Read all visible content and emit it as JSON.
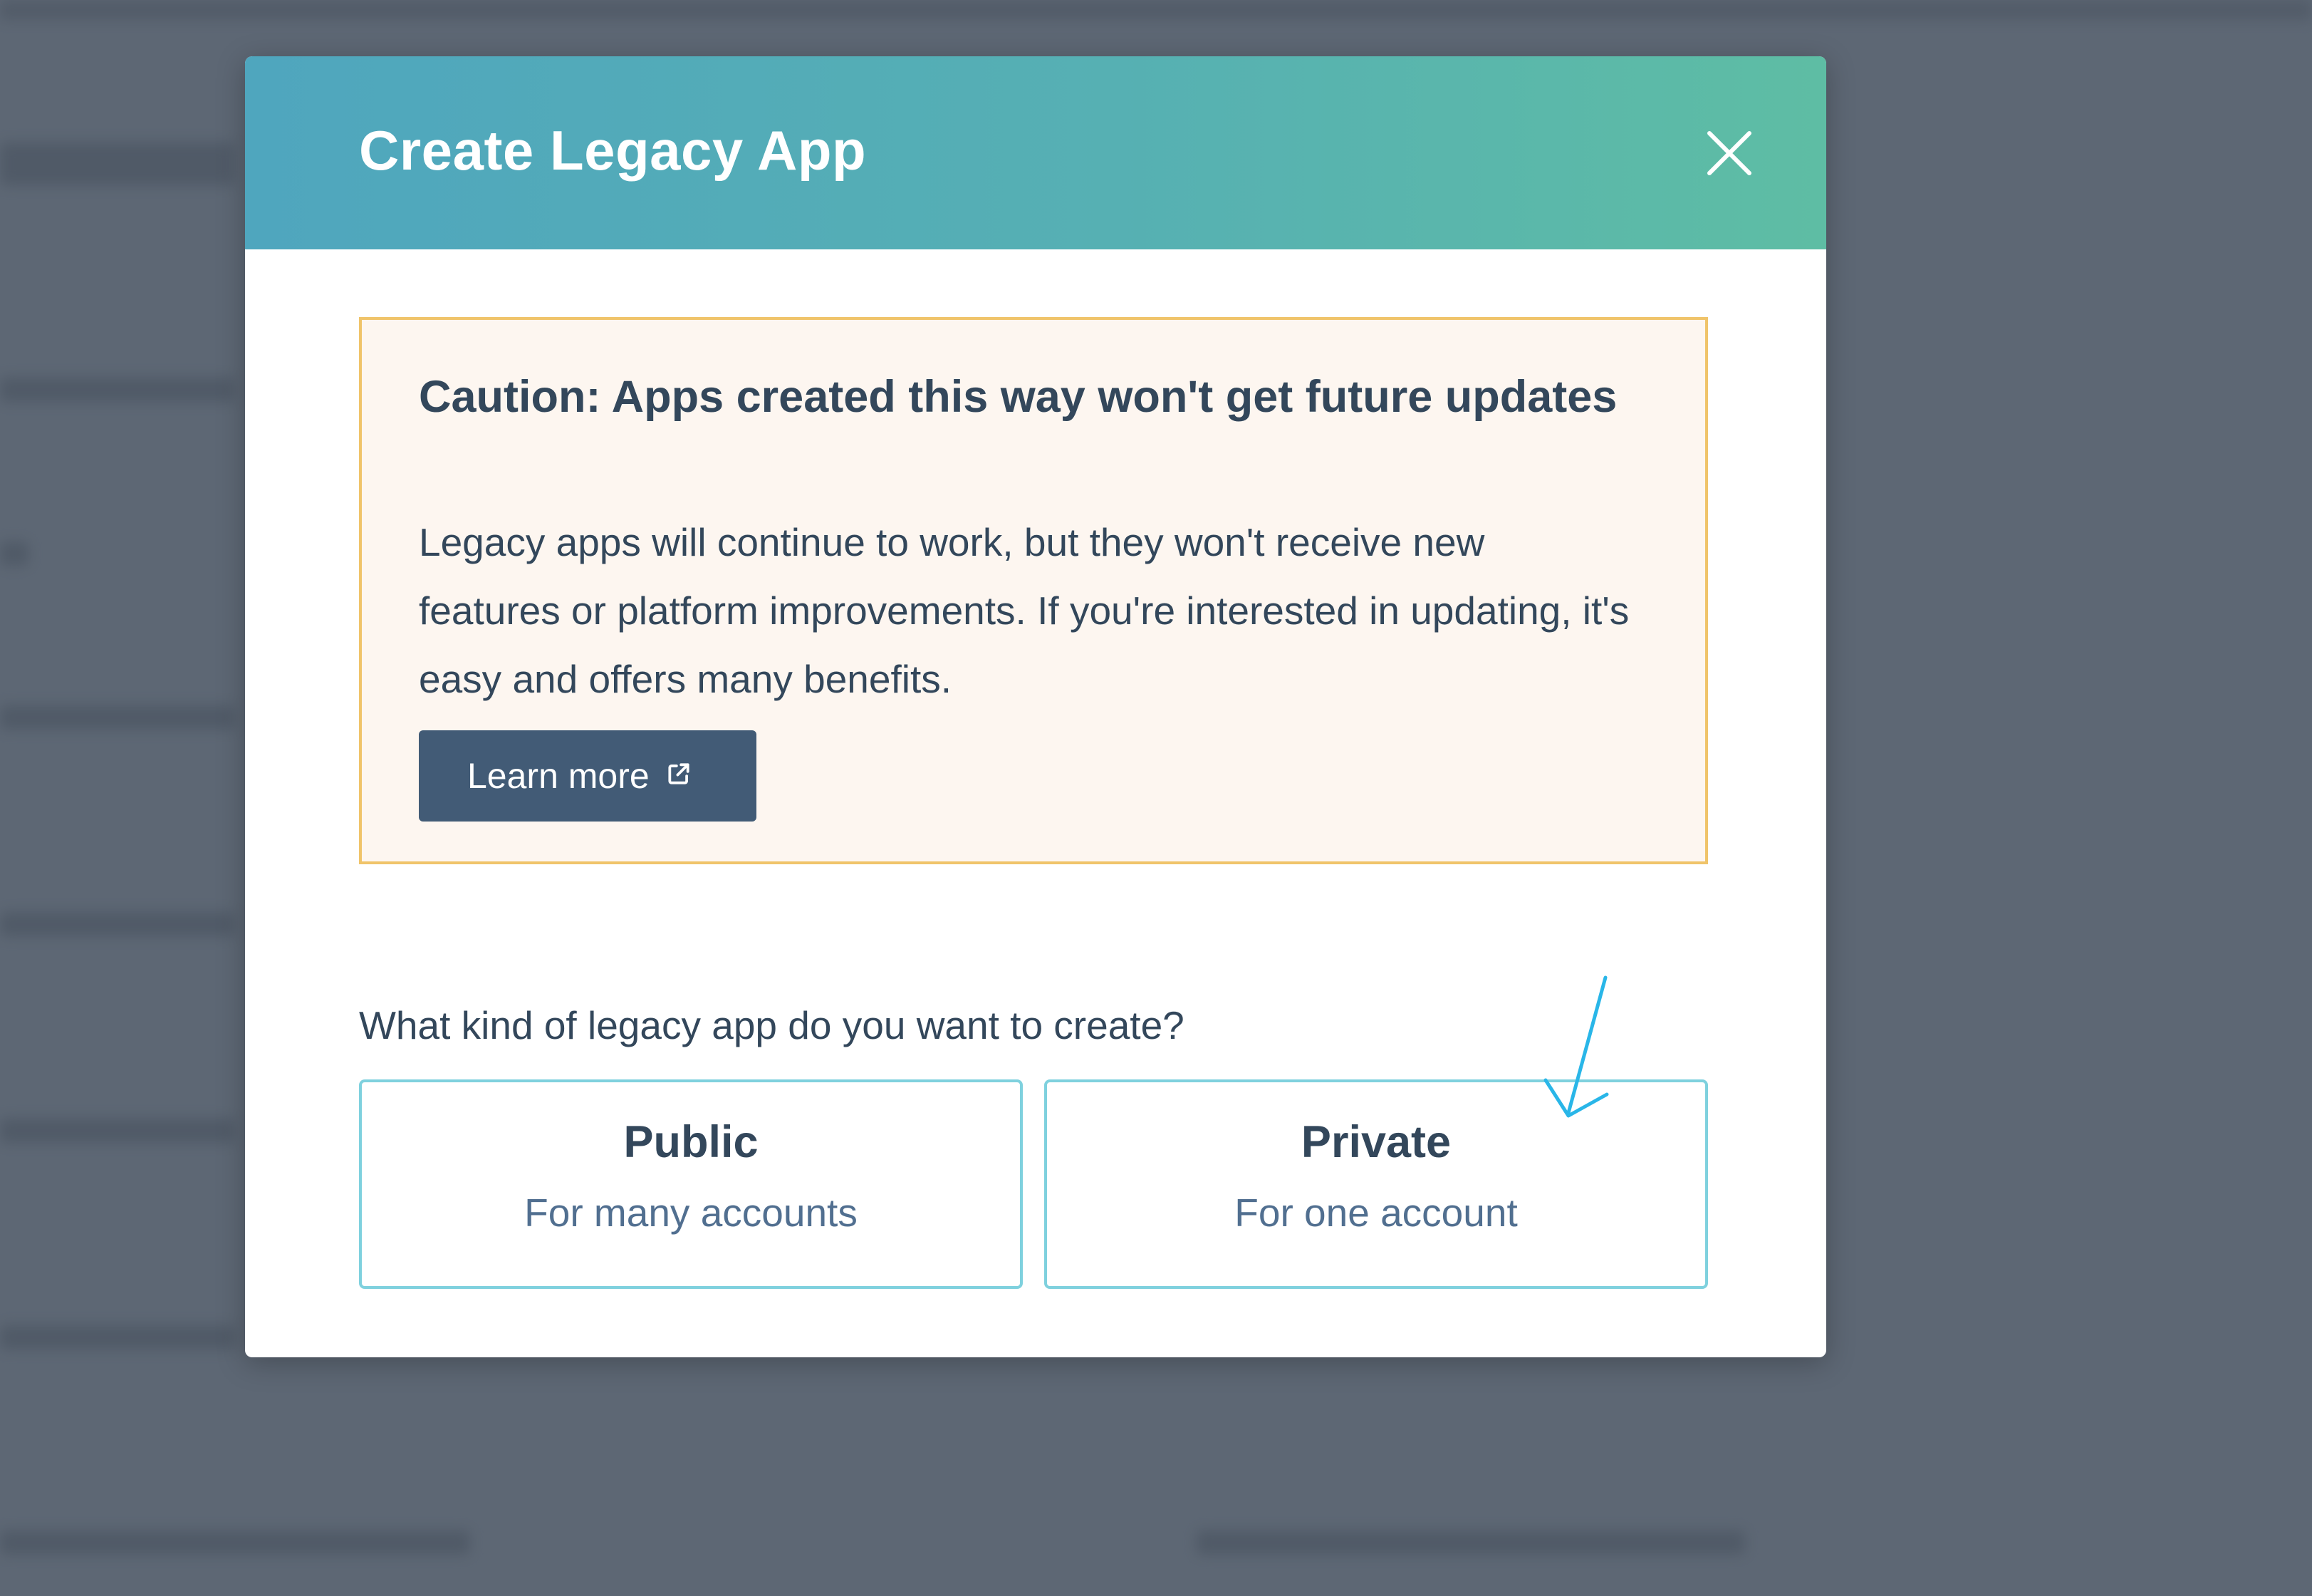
{
  "modal": {
    "title": "Create Legacy App",
    "close_icon": "close-icon"
  },
  "caution": {
    "title": "Caution: Apps created this way won't get future updates",
    "body": "Legacy apps will continue to work, but they won't receive new features or platform improvements. If you're interested in updating, it's easy and offers many benefits.",
    "learn_more_label": "Learn more",
    "learn_more_icon": "external-link-icon",
    "border_color": "#f0c46a",
    "background_color": "#fdf6f0"
  },
  "question": "What kind of legacy app do you want to create?",
  "choices": [
    {
      "title": "Public",
      "subtitle": "For many accounts"
    },
    {
      "title": "Private",
      "subtitle": "For one account"
    }
  ],
  "colors": {
    "header_gradient_start": "#4fa6be",
    "header_gradient_end": "#5ebda4",
    "primary_text": "#33475b",
    "choice_border": "#7fd1de",
    "button_bg": "#425b76",
    "annotation_arrow": "#29b6e8"
  }
}
